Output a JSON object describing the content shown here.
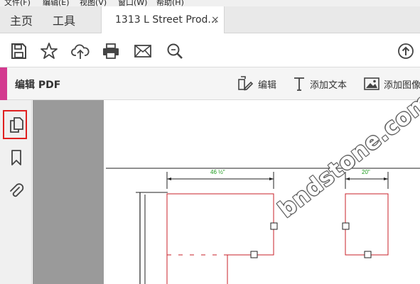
{
  "menu": {
    "items": [
      "文件(F)",
      "编辑(E)",
      "视图(V)",
      "窗口(W)",
      "帮助(H)"
    ]
  },
  "tabs": {
    "home": "主页",
    "tools": "工具",
    "document": "1313 L Street Prod...",
    "close": "×"
  },
  "toolbar": {
    "icons": [
      "save-icon",
      "star-icon",
      "upload-icon",
      "print-icon",
      "mail-icon",
      "search-zoom-icon",
      "share-up-icon"
    ]
  },
  "edit_bar": {
    "title": "编辑 PDF",
    "edit_label": "编辑",
    "add_text_label": "添加文本",
    "add_image_label": "添加图像",
    "accent_color": "#d33a8f"
  },
  "left_nav": {
    "icons": [
      "pages-icon",
      "bookmark-icon",
      "attachment-icon"
    ],
    "highlight_color": "#e02020"
  },
  "drawing": {
    "dim_left": "46 ½\"",
    "dim_right": "20\"",
    "dim_color": "#1a9a1a",
    "outline_color": "#c8202a"
  },
  "watermark": "bndstone.com"
}
